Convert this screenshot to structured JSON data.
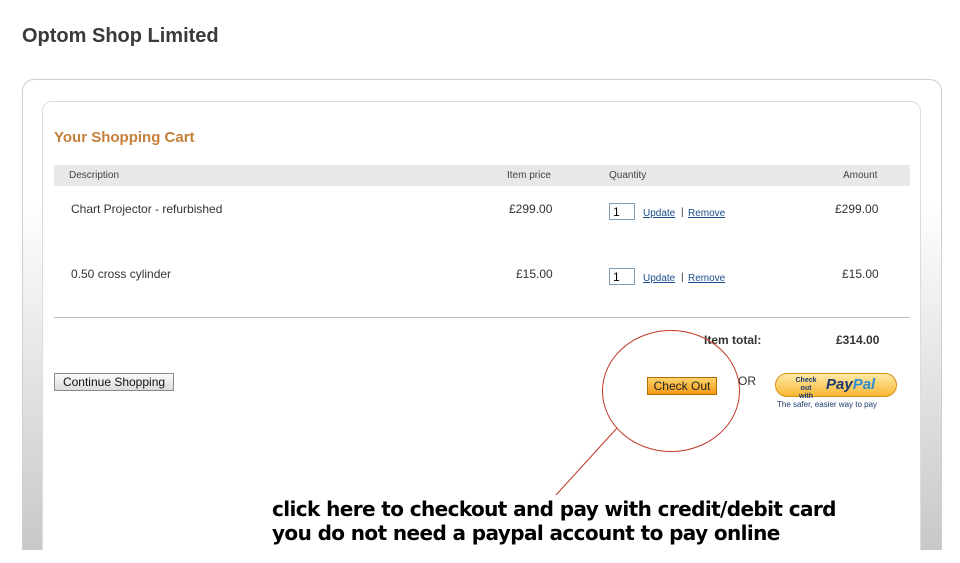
{
  "shop": {
    "title": "Optom Shop Limited"
  },
  "cart": {
    "heading": "Your Shopping Cart",
    "columns": {
      "description": "Description",
      "item_price": "Item price",
      "quantity": "Quantity",
      "amount": "Amount"
    },
    "items": [
      {
        "description": "Chart Projector - refurbished",
        "price": "£299.00",
        "quantity": "1",
        "amount": "£299.00"
      },
      {
        "description": "0.50 cross cylinder",
        "price": "£15.00",
        "quantity": "1",
        "amount": "£15.00"
      }
    ],
    "update_label": "Update",
    "remove_label": "Remove",
    "separator": "|",
    "total_label": "Item total:",
    "total_value": "£314.00"
  },
  "actions": {
    "continue_label": "Continue Shopping",
    "checkout_label": "Check Out",
    "or_label": "OR",
    "paypal_small_line1": "Check out",
    "paypal_small_line2": "with",
    "paypal_brand_pay": "Pay",
    "paypal_brand_pal": "Pal",
    "paypal_tagline": "The safer, easier way to pay"
  },
  "annotation": {
    "line1": "click here to checkout and pay with credit/debit card",
    "line2": "you do not need a paypal account to pay online",
    "color": "#c0392b"
  },
  "colors": {
    "heading": "#c47f3a",
    "link": "#1a4d8c",
    "checkout": "#f29a16"
  }
}
